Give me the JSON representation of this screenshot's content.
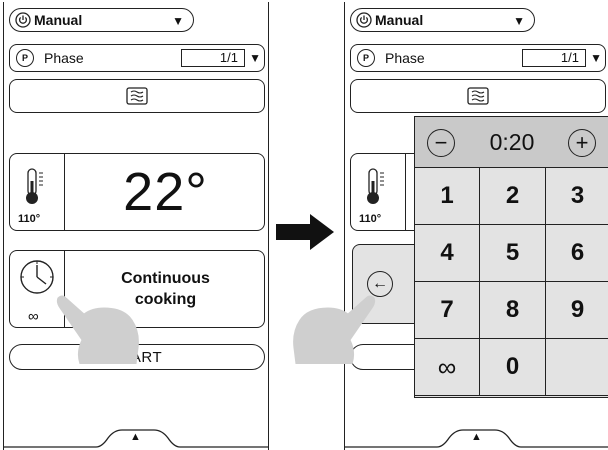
{
  "mode": {
    "label": "Manual"
  },
  "phase": {
    "label": "Phase",
    "icon_text": "P",
    "value": "1/1"
  },
  "temperature": {
    "value": "22°",
    "setpoint": "110°"
  },
  "time": {
    "label": "Continuous\ncooking",
    "infinity": "∞"
  },
  "start": {
    "label": "START"
  },
  "keypad": {
    "time_display": "0:20",
    "minus": "−",
    "plus": "+",
    "keys": [
      "1",
      "2",
      "3",
      "4",
      "5",
      "6",
      "7",
      "8",
      "9",
      "∞",
      "0",
      ""
    ]
  },
  "icons": {
    "mode_dropdown": "▼",
    "phase_dropdown": "▼",
    "bottom_tab": "▲",
    "back": "←"
  }
}
